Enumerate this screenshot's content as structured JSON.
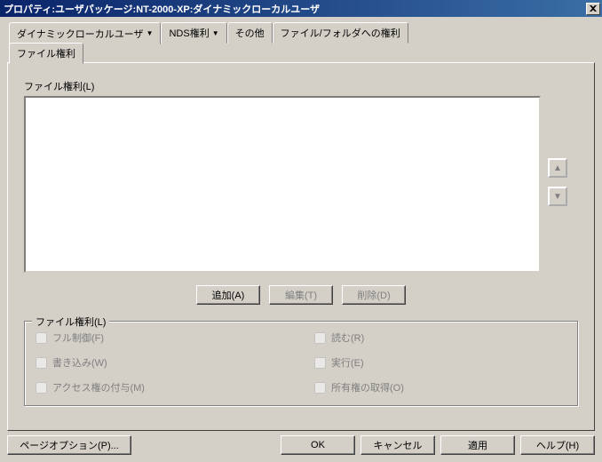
{
  "title": "プロパティ:ユーザパッケージ:NT-2000-XP:ダイナミックローカルユーザ",
  "tabs": {
    "dlu": "ダイナミックローカルユーザ",
    "nds": "NDS権利",
    "other": "その他",
    "file_folder": "ファイル/フォルダへの権利",
    "file_rights": "ファイル権利"
  },
  "main": {
    "list_label": "ファイル権利(L)",
    "buttons": {
      "add": "追加(A)",
      "edit": "編集(T)",
      "delete": "削除(D)"
    }
  },
  "group": {
    "legend": "ファイル権利(L)",
    "full": "フル制御(F)",
    "read": "読む(R)",
    "write": "書き込み(W)",
    "execute": "実行(E)",
    "grant": "アクセス権の付与(M)",
    "take_own": "所有権の取得(O)"
  },
  "footer": {
    "page_options": "ページオプション(P)...",
    "ok": "OK",
    "cancel": "キャンセル",
    "apply": "適用",
    "help": "ヘルプ(H)"
  }
}
